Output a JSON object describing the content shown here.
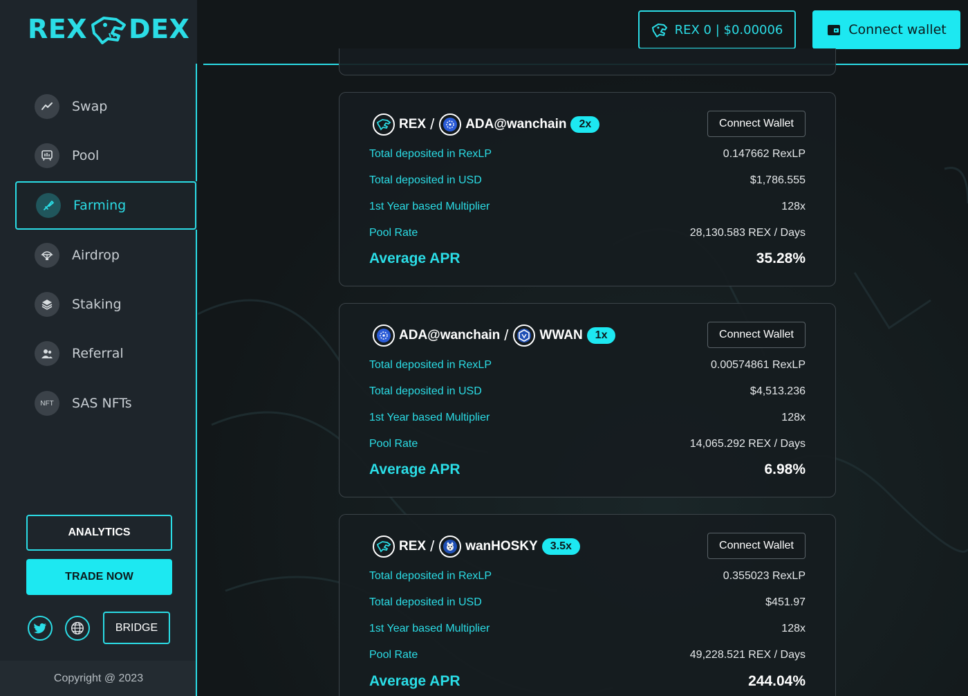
{
  "brand": {
    "left": "REX",
    "right": "DEX"
  },
  "nav": [
    {
      "label": "Swap",
      "icon": "chart-line-icon"
    },
    {
      "label": "Pool",
      "icon": "pool-icon"
    },
    {
      "label": "Farming",
      "icon": "farming-icon"
    },
    {
      "label": "Airdrop",
      "icon": "parachute-icon"
    },
    {
      "label": "Staking",
      "icon": "layers-icon"
    },
    {
      "label": "Referral",
      "icon": "users-icon"
    },
    {
      "label": "SAS NFTs",
      "icon": "nft-icon",
      "icon_text": "NFT"
    }
  ],
  "sidebar_buttons": {
    "analytics": "ANALYTICS",
    "trade": "TRADE NOW",
    "bridge": "BRIDGE"
  },
  "social": [
    "twitter-icon",
    "globe-icon"
  ],
  "copyright": "Copyright @ 2023",
  "header": {
    "price_label": "REX 0 | $0.00006",
    "connect_label": "Connect wallet"
  },
  "labels": {
    "deposited_lp": "Total deposited in RexLP",
    "deposited_usd": "Total deposited in USD",
    "multiplier": "1st Year based Multiplier",
    "pool_rate": "Pool Rate",
    "apr": "Average APR",
    "connect": "Connect Wallet",
    "sep": "/"
  },
  "farms": [
    {
      "token_a": "REX",
      "token_b": "ADA@wanchain",
      "multiplier": "2x",
      "deposited_lp": "0.147662 RexLP",
      "deposited_usd": "$1,786.555",
      "year_multiplier": "128x",
      "pool_rate": "28,130.583 REX / Days",
      "apr": "35.28%"
    },
    {
      "token_a": "ADA@wanchain",
      "token_b": "WWAN",
      "multiplier": "1x",
      "deposited_lp": "0.00574861 RexLP",
      "deposited_usd": "$4,513.236",
      "year_multiplier": "128x",
      "pool_rate": "14,065.292 REX / Days",
      "apr": "6.98%"
    },
    {
      "token_a": "REX",
      "token_b": "wanHOSKY",
      "multiplier": "3.5x",
      "deposited_lp": "0.355023 RexLP",
      "deposited_usd": "$451.97",
      "year_multiplier": "128x",
      "pool_rate": "49,228.521 REX / Days",
      "apr": "244.04%"
    }
  ],
  "colors": {
    "accent": "#1de8f1",
    "sidebar": "#1e252b",
    "background": "#121719"
  }
}
